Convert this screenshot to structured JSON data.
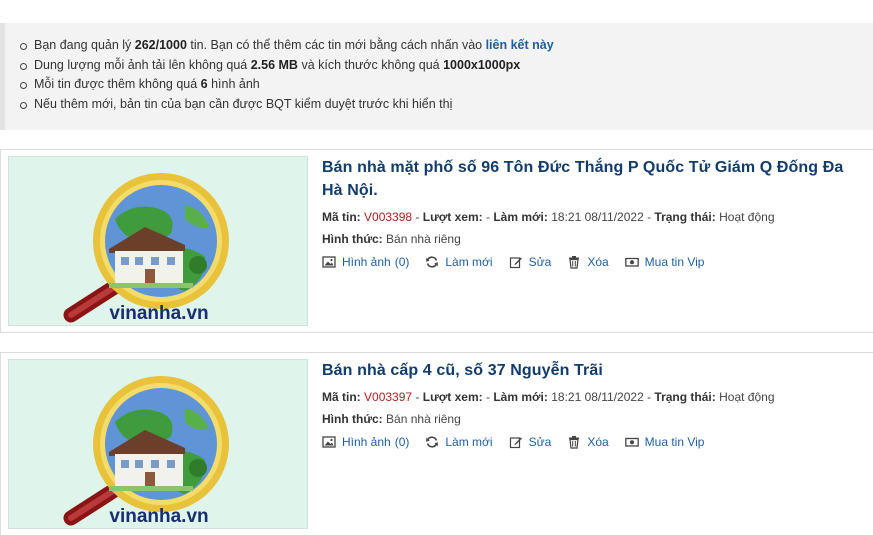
{
  "notice": {
    "line1_pre": "Bạn đang quản lý ",
    "line1_count": "262/1000",
    "line1_mid": " tin. Bạn có thể thêm các tin mới bằng cách nhấn vào ",
    "line1_link": "liên kết này",
    "line2_pre": "Dung lượng mỗi ảnh tải lên không quá ",
    "line2_size": "2.56 MB",
    "line2_mid": " và kích thước không quá ",
    "line2_dim": "1000x1000px",
    "line3_pre": "Mỗi tin được thêm không quá ",
    "line3_count": "6",
    "line3_post": " hình ảnh",
    "line4": "Nếu thêm mới, bản tin của bạn cần được BQT kiểm duyệt trước khi hiển thị"
  },
  "labels": {
    "code": "Mã tin:",
    "views": "Lượt xem:",
    "refreshed": "Làm mới:",
    "status": "Trạng thái:",
    "form": "Hình thức:",
    "sep": " - "
  },
  "actions": {
    "images": "Hình ảnh",
    "refresh": "Làm mới",
    "edit": "Sửa",
    "delete": "Xóa",
    "vip": "Mua tin Vip"
  },
  "listings": [
    {
      "title": "Bán nhà mặt phố số 96 Tôn Đức Thắng P Quốc Tử Giám Q Đống Đa Hà Nội.",
      "code": "V003398",
      "views": "",
      "refreshed": "18:21 08/11/2022",
      "status": "Hoạt động",
      "form": "Bán nhà riêng",
      "image_count": "(0)",
      "logo_text": "vinanha.vn"
    },
    {
      "title": "Bán nhà cấp 4 cũ, số 37 Nguyễn Trãi",
      "code": "V003397",
      "views": "",
      "refreshed": "18:21 08/11/2022",
      "status": "Hoạt động",
      "form": "Bán nhà riêng",
      "image_count": "(0)",
      "logo_text": "vinanha.vn"
    }
  ],
  "colors": {
    "title": "#123c6b",
    "link": "#1f5fa0",
    "code": "#b21e1e",
    "thumb_bg": "#dff5ec"
  }
}
